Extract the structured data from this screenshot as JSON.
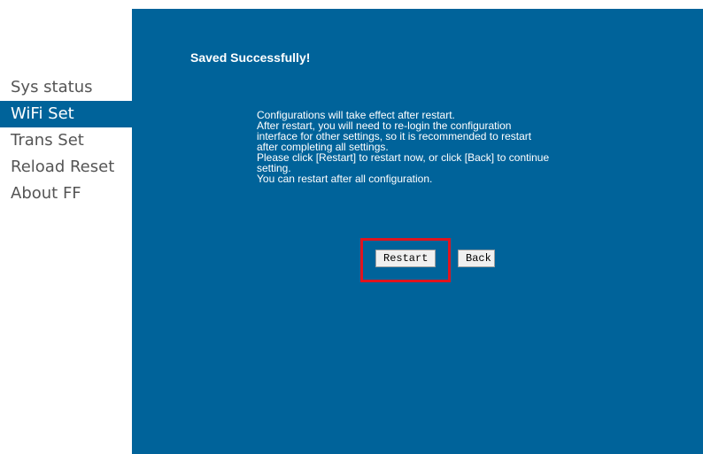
{
  "sidebar": {
    "items": [
      {
        "label": "Sys status",
        "active": false
      },
      {
        "label": "WiFi Set",
        "active": true
      },
      {
        "label": "Trans Set",
        "active": false
      },
      {
        "label": "Reload Reset",
        "active": false
      },
      {
        "label": "About FF",
        "active": false
      }
    ]
  },
  "main": {
    "title": "Saved Successfully!",
    "message_lines": [
      "Configurations will take effect after restart.",
      "After restart, you will need to re-login the configuration",
      "interface for other settings, so it is recommended to restart",
      "after completing all settings.",
      "Please click [Restart] to restart now, or click [Back] to continue",
      "setting.",
      "You can restart after all configuration."
    ],
    "restart_label": "Restart",
    "back_label": "Back"
  },
  "colors": {
    "panel_background": "#00639a",
    "active_item_background": "#00639a",
    "highlight_border": "#e0141e",
    "sidebar_text": "#555555"
  }
}
